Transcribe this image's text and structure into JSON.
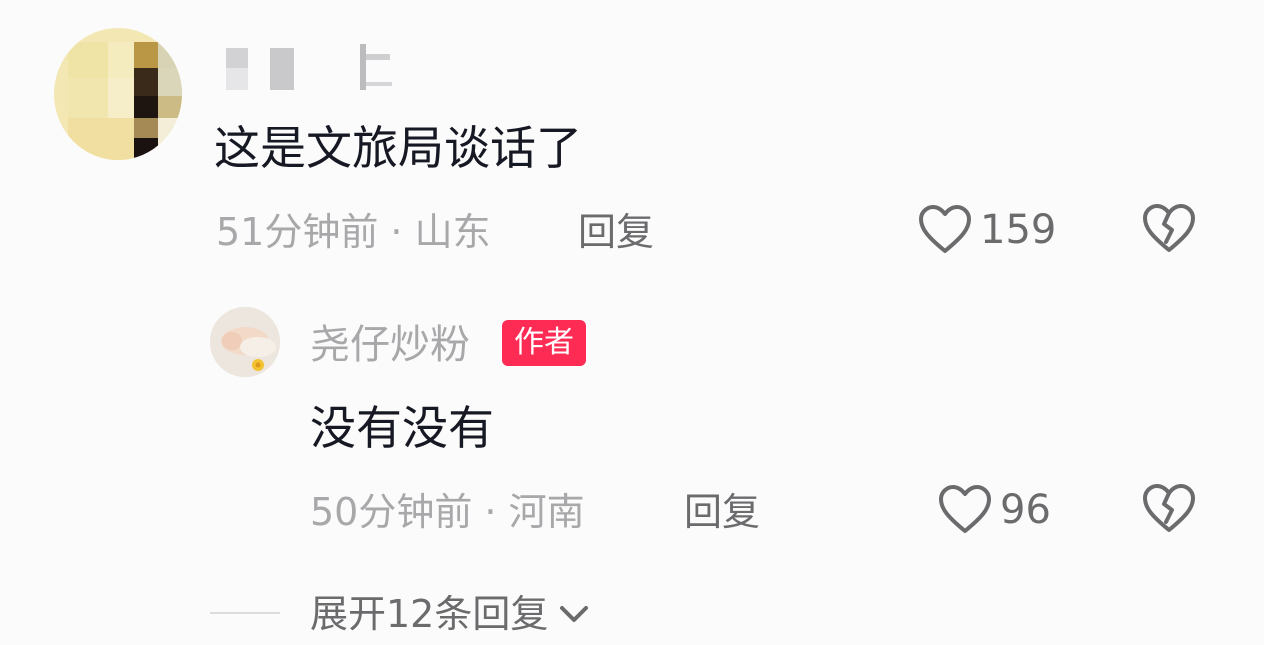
{
  "comment": {
    "author_name": "",
    "text": "这是文旅局谈话了",
    "time_location": "51分钟前 · 山东",
    "reply_label": "回复",
    "like_icon": "heart-outline-icon",
    "like_count": "159",
    "dislike_icon": "broken-heart-icon"
  },
  "reply": {
    "author_name": "尧仔炒粉",
    "author_badge": "作者",
    "text": "没有没有",
    "time_location": "50分钟前 · 河南",
    "reply_label": "回复",
    "like_icon": "heart-outline-icon",
    "like_count": "96",
    "dislike_icon": "broken-heart-icon"
  },
  "expand": {
    "label": "展开12条回复",
    "icon": "chevron-down-icon"
  },
  "colors": {
    "badge": "#fe2c55",
    "text_primary": "#161823",
    "text_secondary": "#a8a8ab",
    "text_action": "#6b6b6e",
    "background": "#fbfbfb"
  }
}
